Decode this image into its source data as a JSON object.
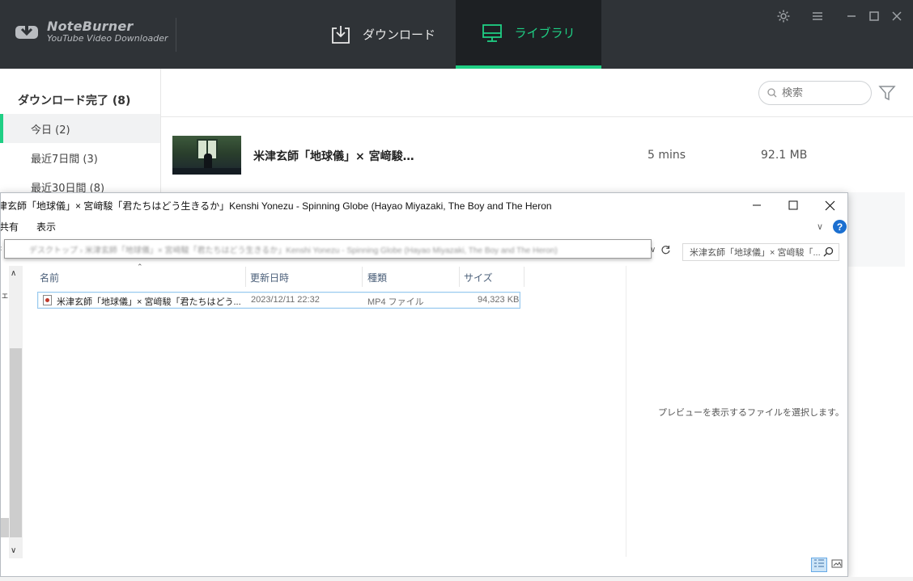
{
  "app": {
    "logo_name": "NoteBurner",
    "logo_sub": "YouTube Video Downloader",
    "tabs": [
      {
        "label": "ダウンロード",
        "icon": "download-icon",
        "active": false
      },
      {
        "label": "ライブラリ",
        "icon": "monitor-icon",
        "active": true
      }
    ],
    "accent_color": "#1fcf84",
    "header_color": "#2f3337",
    "window_controls": [
      "settings-icon",
      "menu-icon",
      "minimize-icon",
      "maximize-icon",
      "close-icon"
    ]
  },
  "sidebar": {
    "heading": "ダウンロード完了 (8)",
    "items": [
      {
        "label": "今日 (2)",
        "active": true
      },
      {
        "label": "最近7日間 (3)",
        "active": false
      },
      {
        "label": "最近30日間 (8)",
        "active": false
      }
    ]
  },
  "main": {
    "search_placeholder": "検索",
    "tracks": [
      {
        "title": "米津玄師「地球儀」× 宮﨑駿…",
        "duration": "5 mins",
        "size": "92.1 MB"
      }
    ]
  },
  "explorer": {
    "title": "津玄師「地球儀」× 宮﨑駿「君たちはどう生きるか」Kenshi Yonezu - Spinning Globe (Hayao Miyazaki, The Boy and The Heron",
    "ribbon": [
      "共有",
      "表示"
    ],
    "address_text": "デスクトップ  ›  米津玄師「地球儀」× 宮﨑駿「君たちはどう生きるか」Kenshi Yonezu - Spinning Globe (Hayao Miyazaki, The Boy and The Heron)",
    "search_text": "米津玄師「地球儀」× 宮﨑駿「...",
    "columns": [
      "名前",
      "更新日時",
      "種類",
      "サイズ"
    ],
    "files": [
      {
        "name": "米津玄師「地球儀」× 宮﨑駿「君たちはどう...",
        "date": "2023/12/11 22:32",
        "type": "MP4 ファイル",
        "size": "94,323 KB"
      }
    ],
    "preview_text": "プレビューを表示するファイルを選択します。",
    "nav_fragment": "ェ-"
  }
}
